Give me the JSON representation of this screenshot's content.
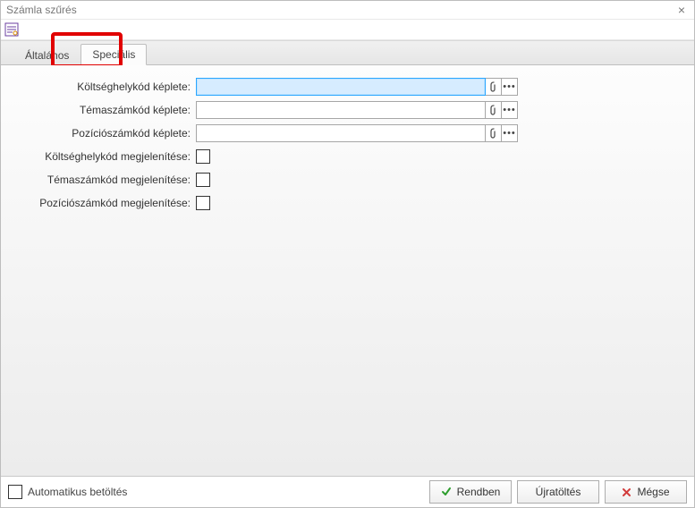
{
  "window": {
    "title": "Számla szűrés"
  },
  "tabs": {
    "general": "Általános",
    "special": "Speciális",
    "active": "special"
  },
  "fields": {
    "cost_code_formula": {
      "label": "Költséghelykód képlete:",
      "value": ""
    },
    "topic_code_formula": {
      "label": "Témaszámkód képlete:",
      "value": ""
    },
    "position_code_formula": {
      "label": "Pozíciószámkód képlete:",
      "value": ""
    },
    "cost_code_display": {
      "label": "Költséghelykód megjelenítése:",
      "checked": false
    },
    "topic_code_display": {
      "label": "Témaszámkód megjelenítése:",
      "checked": false
    },
    "position_code_display": {
      "label": "Pozíciószámkód megjelenítése:",
      "checked": false
    }
  },
  "footer": {
    "auto_load": {
      "label": "Automatikus betöltés",
      "checked": false
    },
    "ok": "Rendben",
    "reload": "Újratöltés",
    "cancel": "Mégse"
  }
}
